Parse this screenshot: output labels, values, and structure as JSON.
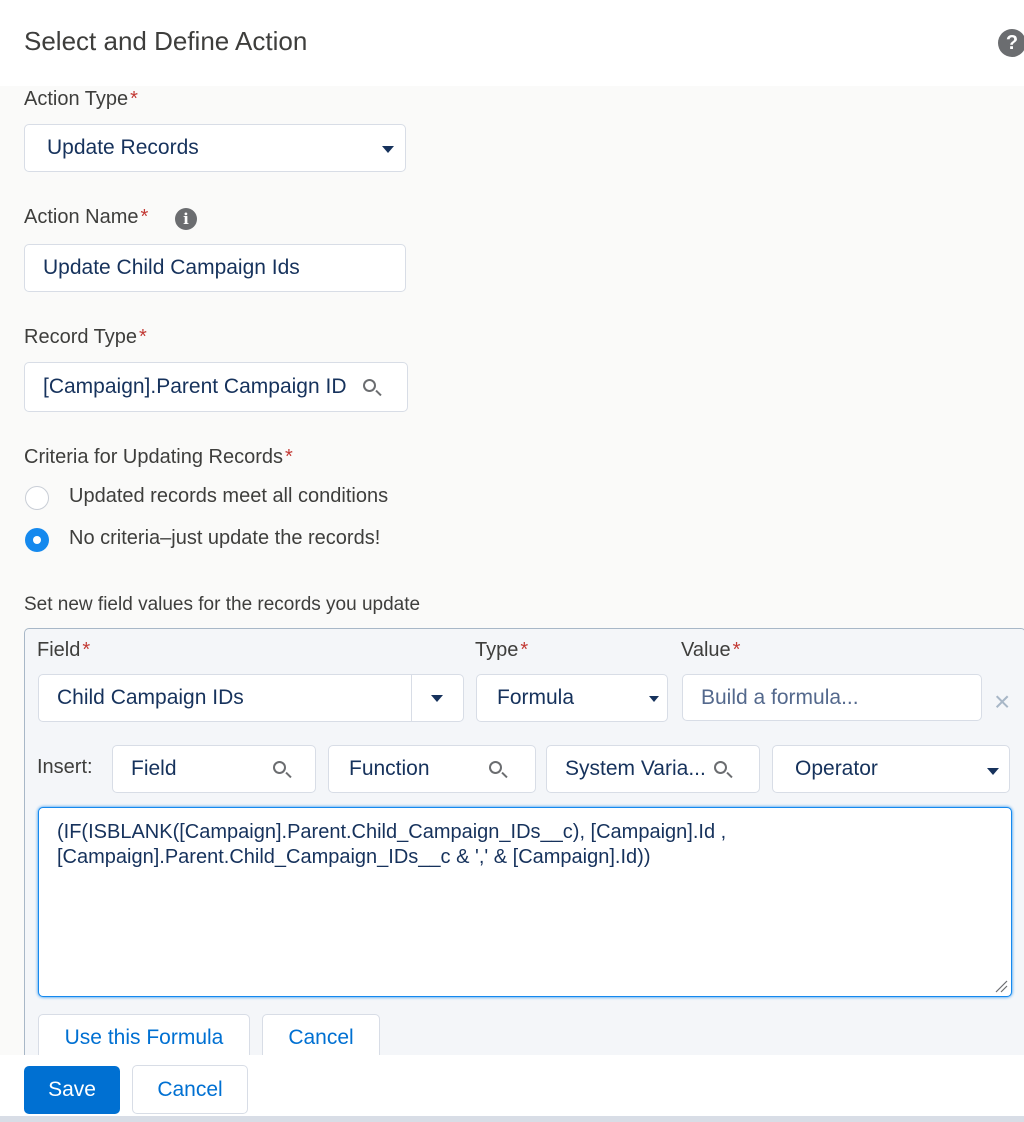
{
  "dialog": {
    "title": "Select and Define Action",
    "help_icon": "question-icon"
  },
  "action_type": {
    "label": "Action Type",
    "required": "*",
    "value": "Update Records"
  },
  "action_name": {
    "label": "Action Name",
    "required": "*",
    "value": "Update Child Campaign Ids",
    "info_icon": "info-icon"
  },
  "record_type": {
    "label": "Record Type",
    "required": "*",
    "value": "[Campaign].Parent Campaign ID",
    "search_icon": "search-icon"
  },
  "criteria": {
    "label": "Criteria for Updating Records",
    "required": "*",
    "options": [
      {
        "label": "Updated records meet all conditions",
        "selected": false
      },
      {
        "label": "No criteria–just update the records!",
        "selected": true
      }
    ]
  },
  "field_values": {
    "heading": "Set new field values for the records you update",
    "field_label": "Field",
    "type_label": "Type",
    "value_label": "Value",
    "required": "*",
    "field_value": "Child Campaign IDs",
    "type_value": "Formula",
    "value_placeholder": "Build a formula...",
    "insert_label": "Insert:",
    "insert_field": "Field",
    "insert_function": "Function",
    "insert_system": "System Varia...",
    "insert_operator": "Operator",
    "formula_line1": "(IF(ISBLANK([Campaign].Parent.Child_Campaign_IDs__c), [Campaign].Id ,",
    "formula_line2": "[Campaign].Parent.Child_Campaign_IDs__c & ',' & [Campaign].Id))",
    "use_formula_button": "Use this Formula",
    "cancel_button": "Cancel"
  },
  "footer": {
    "save_button": "Save",
    "cancel_button": "Cancel"
  },
  "colors": {
    "brand": "#0070d2",
    "required": "#c23934",
    "focus": "#1589ee"
  }
}
